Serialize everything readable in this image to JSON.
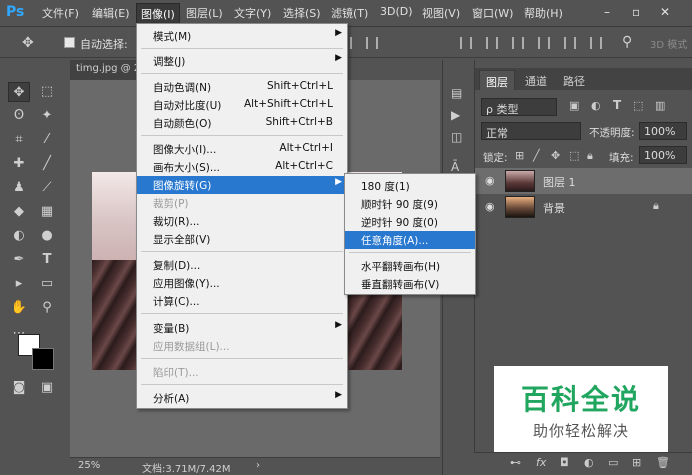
{
  "app": {
    "logo": "Ps"
  },
  "menubar": [
    {
      "label": "文件(F)"
    },
    {
      "label": "编辑(E)"
    },
    {
      "label": "图像(I)"
    },
    {
      "label": "图层(L)"
    },
    {
      "label": "文字(Y)"
    },
    {
      "label": "选择(S)"
    },
    {
      "label": "滤镜(T)"
    },
    {
      "label": "3D(D)"
    },
    {
      "label": "视图(V)"
    },
    {
      "label": "窗口(W)"
    },
    {
      "label": "帮助(H)"
    }
  ],
  "window_controls": {
    "minimize": "–",
    "restore": "▫",
    "close": "✕"
  },
  "options": {
    "autoselect_label": "自动选择:",
    "mode_3d": "3D 模式"
  },
  "document": {
    "tab_title": "timg.jpg @ 2",
    "zoom": "25%",
    "doc_info": "文档:3.71M/7.42M"
  },
  "image_menu": {
    "items": [
      {
        "label": "模式(M)",
        "shortcut": "",
        "submenu": true,
        "disabled": false
      },
      {
        "label": "调整(J)",
        "shortcut": "",
        "submenu": true,
        "disabled": false
      },
      {
        "label": "自动色调(N)",
        "shortcut": "Shift+Ctrl+L",
        "disabled": false
      },
      {
        "label": "自动对比度(U)",
        "shortcut": "Alt+Shift+Ctrl+L",
        "disabled": false
      },
      {
        "label": "自动颜色(O)",
        "shortcut": "Shift+Ctrl+B",
        "disabled": false
      },
      {
        "label": "图像大小(I)...",
        "shortcut": "Alt+Ctrl+I",
        "disabled": false
      },
      {
        "label": "画布大小(S)...",
        "shortcut": "Alt+Ctrl+C",
        "disabled": false
      },
      {
        "label": "图像旋转(G)",
        "shortcut": "",
        "submenu": true,
        "highlighted": true
      },
      {
        "label": "裁剪(P)",
        "shortcut": "",
        "disabled": true
      },
      {
        "label": "裁切(R)...",
        "shortcut": "",
        "disabled": false
      },
      {
        "label": "显示全部(V)",
        "shortcut": "",
        "disabled": false
      },
      {
        "label": "复制(D)...",
        "shortcut": "",
        "disabled": false
      },
      {
        "label": "应用图像(Y)...",
        "shortcut": "",
        "disabled": false
      },
      {
        "label": "计算(C)...",
        "shortcut": "",
        "disabled": false
      },
      {
        "label": "变量(B)",
        "shortcut": "",
        "submenu": true,
        "disabled": false
      },
      {
        "label": "应用数据组(L)...",
        "shortcut": "",
        "disabled": true
      },
      {
        "label": "陷印(T)...",
        "shortcut": "",
        "disabled": true
      },
      {
        "label": "分析(A)",
        "shortcut": "",
        "submenu": true,
        "disabled": false
      }
    ]
  },
  "rotate_submenu": {
    "items": [
      {
        "label": "180 度(1)"
      },
      {
        "label": "顺时针 90 度(9)"
      },
      {
        "label": "逆时针 90 度(0)"
      },
      {
        "label": "任意角度(A)...",
        "highlighted": true
      },
      {
        "label": "水平翻转画布(H)"
      },
      {
        "label": "垂直翻转画布(V)"
      }
    ]
  },
  "layers_panel": {
    "tabs": [
      "图层",
      "通道",
      "路径"
    ],
    "kind_label": "ρ 类型",
    "blend_mode": "正常",
    "opacity_label": "不透明度:",
    "opacity_value": "100%",
    "lock_label": "锁定:",
    "fill_label": "填充:",
    "fill_value": "100%",
    "layers": [
      {
        "name": "图层 1",
        "selected": true
      },
      {
        "name": "背景",
        "selected": false
      }
    ]
  },
  "watermark": {
    "title": "百科全说",
    "subtitle": "助你轻松解决"
  },
  "colors": {
    "highlight": "#2878d0",
    "menu_bg": "#f0f0f0",
    "ui_bg": "#535353",
    "ps_blue": "#31a8ff",
    "watermark_green": "#21a660"
  }
}
